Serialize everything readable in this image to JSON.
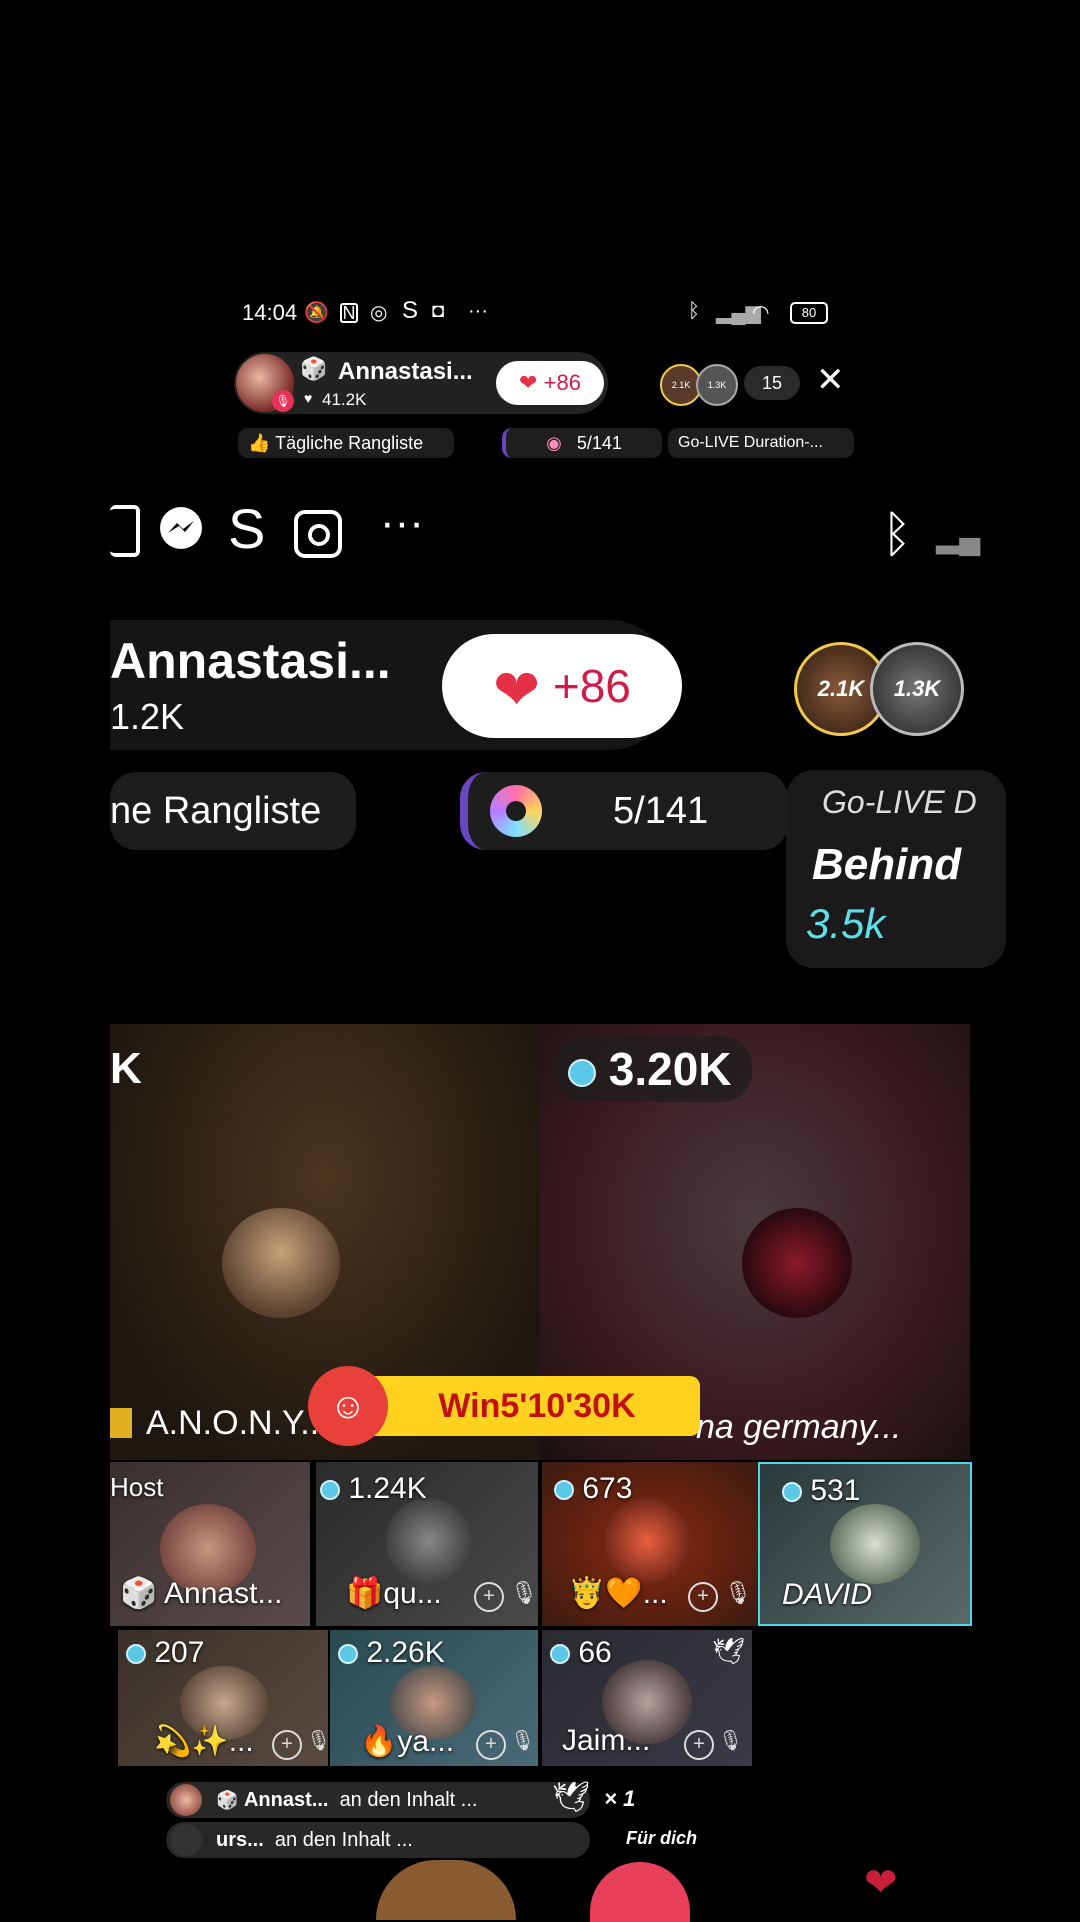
{
  "status_bar": {
    "time": "14:04",
    "icons_left": [
      "bell-off-icon",
      "nfc-icon",
      "messenger-icon",
      "s-app-icon",
      "instagram-icon",
      "more-dots-icon"
    ],
    "icons_right": [
      "bluetooth-icon",
      "signal-icon",
      "wifi-icon"
    ],
    "battery": "80"
  },
  "header": {
    "host_name": "Annastasi...",
    "host_likes": "41.2K",
    "like_count": "+86",
    "viewer_badges": [
      "2.1K",
      "1.3K"
    ],
    "viewer_count": "15",
    "close_label": "✕"
  },
  "chips": {
    "daily_ranking": "Tägliche Rangliste",
    "progress": "5/141",
    "golive": "Go-LIVE Duration-..."
  },
  "zoom": {
    "host_name": "Annastasi...",
    "host_likes": "1.2K",
    "like_count": "+86",
    "viewer_badges": [
      "2.1K",
      "1.3K"
    ],
    "ranking_partial": "ne Rangliste",
    "progress": "5/141",
    "golive_title": "Go-LIVE D",
    "golive_behind": "Behind",
    "golive_value": "3.5k"
  },
  "big_tiles": [
    {
      "score": "K",
      "name": "A.N.O.N.Y..."
    },
    {
      "score": "3.20K",
      "name": "na germany..."
    }
  ],
  "battle_banner": "Win5'10'30K",
  "small_tiles": [
    {
      "score": "Host",
      "name": "Annast..."
    },
    {
      "score": "1.24K",
      "name": "qu..."
    },
    {
      "score": "673",
      "name": "..."
    },
    {
      "score": "531",
      "name": "DAVID"
    },
    {
      "score": "207",
      "name": "..."
    },
    {
      "score": "2.26K",
      "name": "ya..."
    },
    {
      "score": "66",
      "name": "Jaim..."
    }
  ],
  "chat": [
    {
      "user": "Annast...",
      "text": "an den Inhalt ...",
      "gift_count": "× 1"
    },
    {
      "user": "urs...",
      "text": "an den Inhalt ...",
      "tag": "Für dich"
    }
  ]
}
